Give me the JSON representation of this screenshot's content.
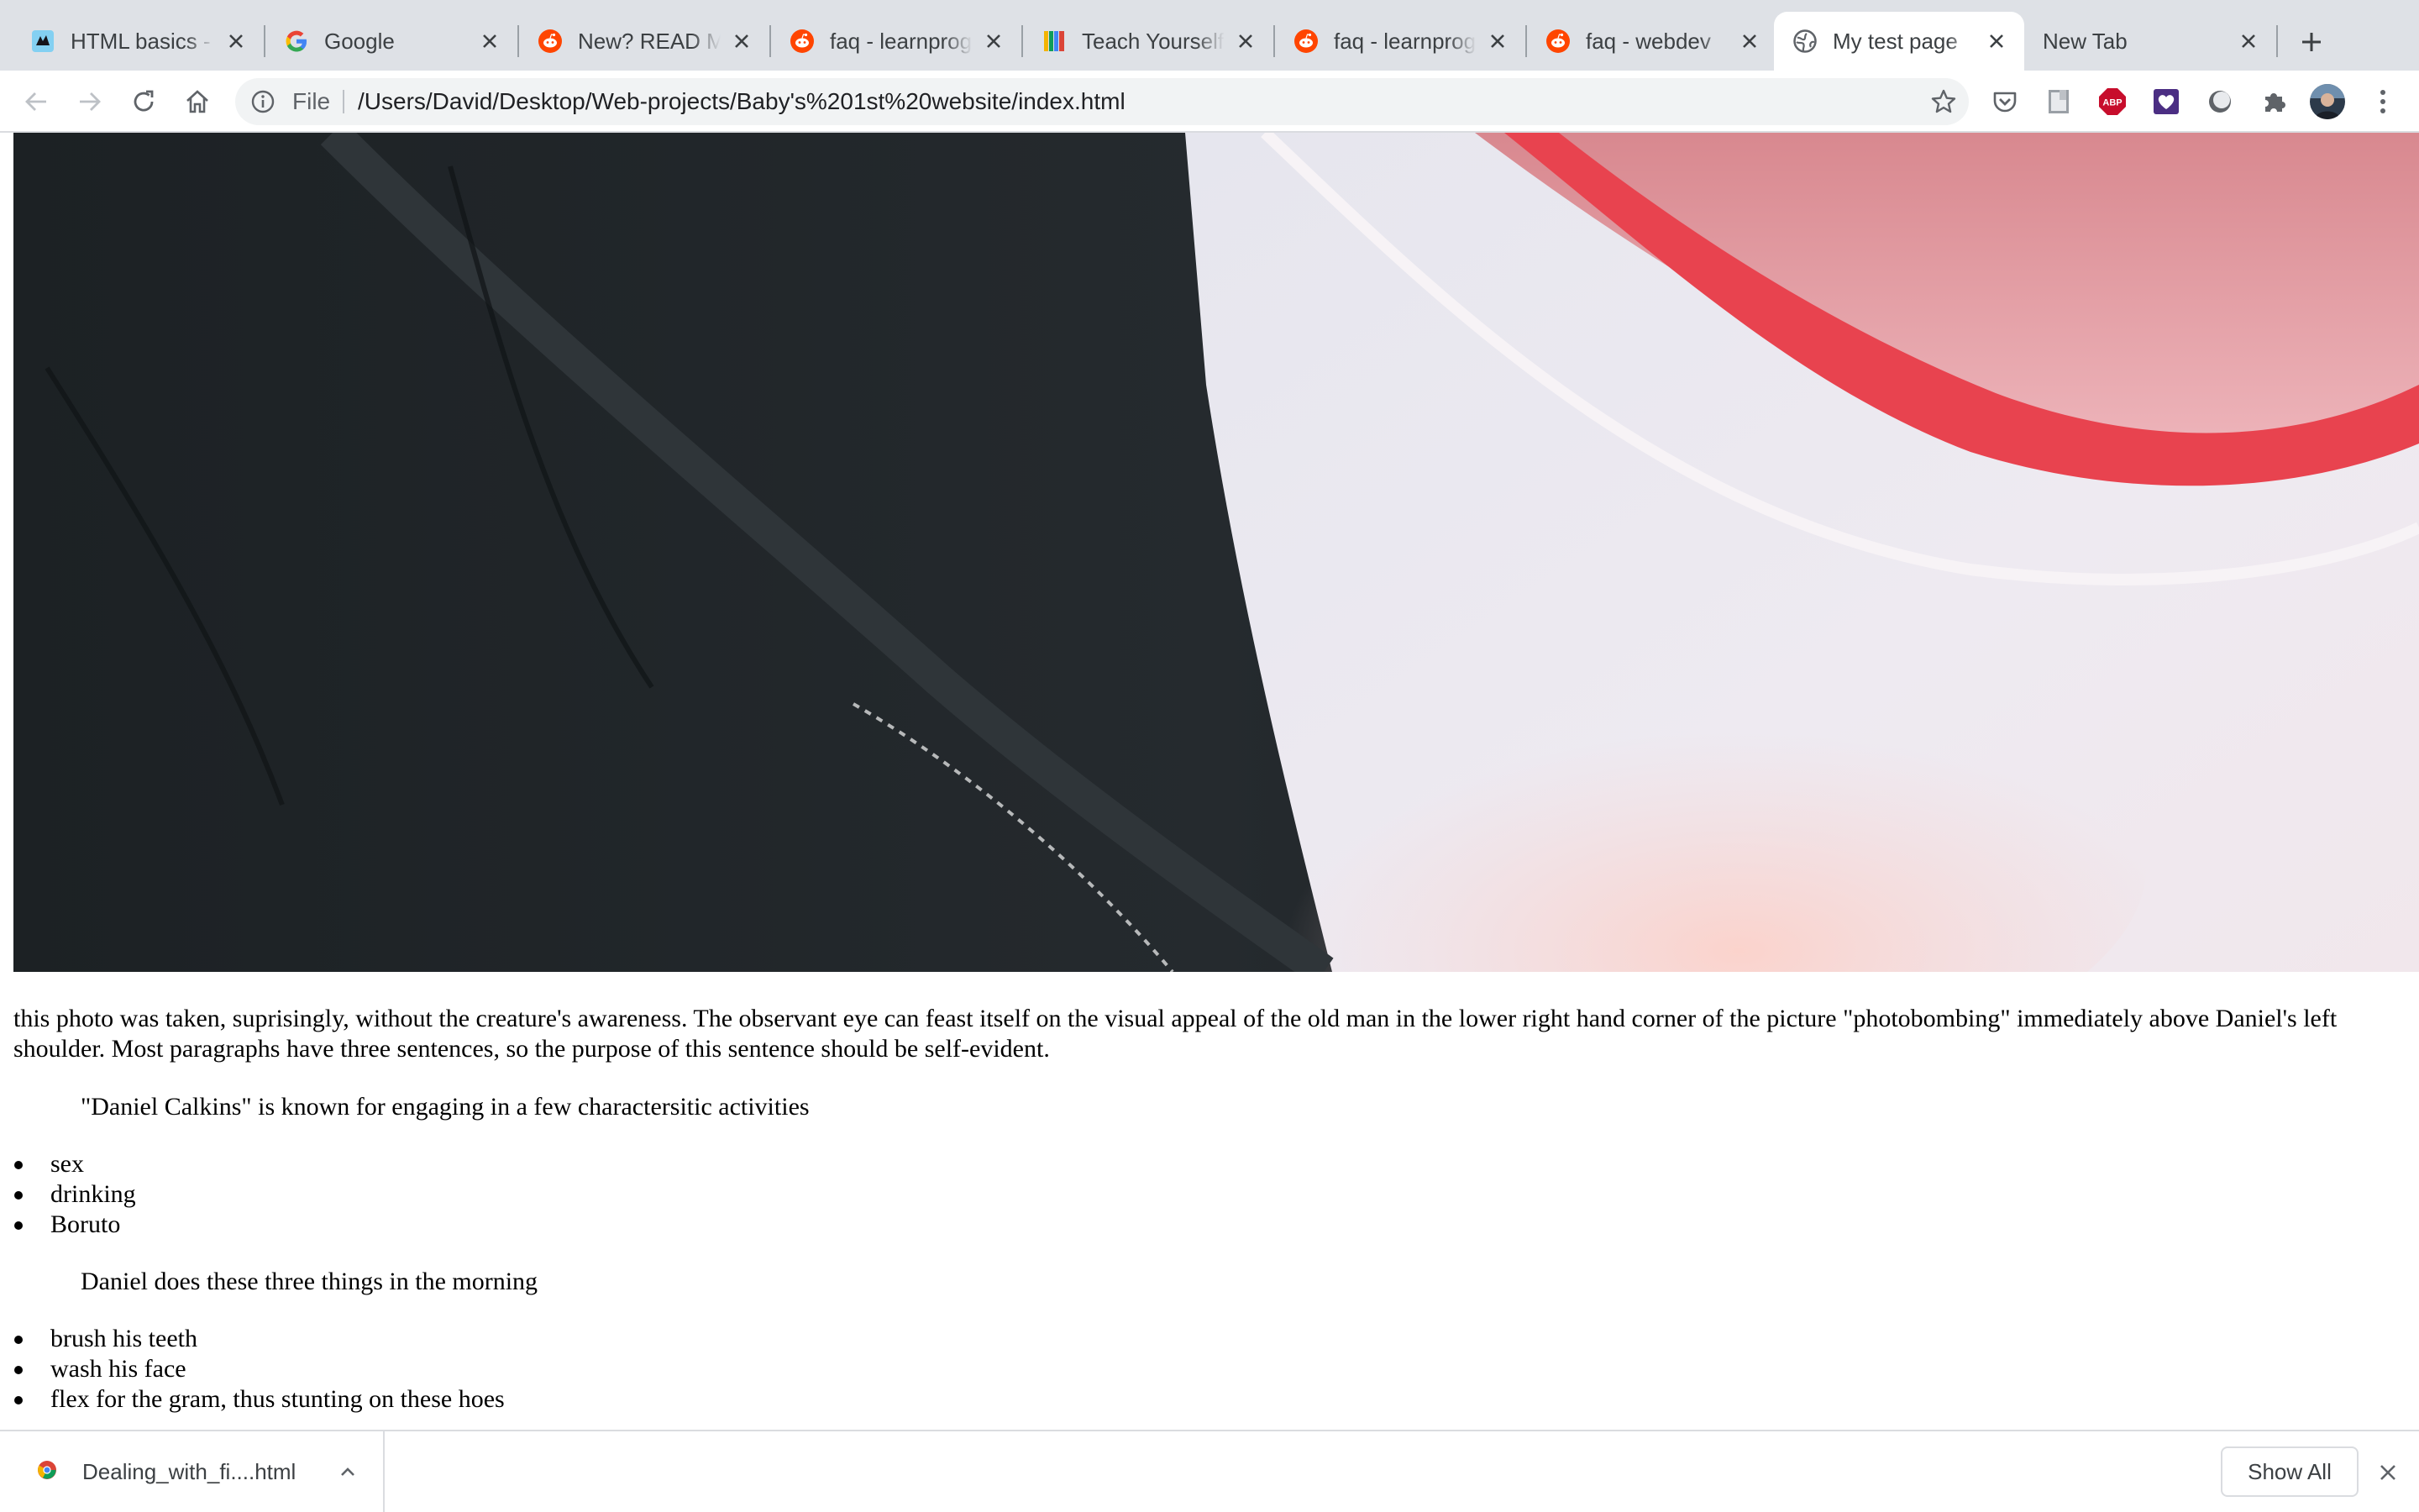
{
  "browser": {
    "tabs": [
      {
        "title": "HTML basics -",
        "icon": "mdn-icon",
        "active": false
      },
      {
        "title": "Google",
        "icon": "google-icon",
        "active": false
      },
      {
        "title": "New? READ ME",
        "icon": "reddit-icon",
        "active": false
      },
      {
        "title": "faq - learnprog",
        "icon": "reddit-icon",
        "active": false
      },
      {
        "title": "Teach Yourself",
        "icon": "teach-yourself-icon",
        "active": false
      },
      {
        "title": "faq - learnprog",
        "icon": "reddit-icon",
        "active": false
      },
      {
        "title": "faq - webdev",
        "icon": "reddit-icon",
        "active": false
      },
      {
        "title": "My test page",
        "icon": "globe-icon",
        "active": true
      },
      {
        "title": "New Tab",
        "icon": "",
        "active": false
      }
    ],
    "omnibox": {
      "scheme_label": "File",
      "url": "/Users/David/Desktop/Web-projects/Baby's%201st%20website/index.html"
    },
    "extensions": [
      "pocket-icon",
      "notes-extension-icon",
      "adblock-plus-icon",
      "heart-extension-icon",
      "circle-extension-icon",
      "puzzle-icon",
      "profile-avatar"
    ],
    "extension_labels": {
      "adblock": "ABP"
    }
  },
  "page": {
    "photo_description_alt": "",
    "paragraph1": "this photo was taken, suprisingly, without the creature's awareness. The observant eye can feast itself on the visual appeal of the old man in the lower right hand corner of the picture \"photobombing\" immediately above Daniel's left shoulder. Most paragraphs have three sentences, so the purpose of this sentence should be self-evident.",
    "paragraph2": "\"Daniel Calkins\" is known for engaging in a few charactersitic activities",
    "list1": [
      "sex",
      "drinking",
      "Boruto"
    ],
    "paragraph3": "Daniel does these three things in the morning",
    "list2": [
      "brush his teeth",
      "wash his face",
      "flex for the gram, thus stunting on these hoes"
    ]
  },
  "download_shelf": {
    "filename": "Dealing_with_fi....html",
    "show_all_label": "Show All"
  }
}
